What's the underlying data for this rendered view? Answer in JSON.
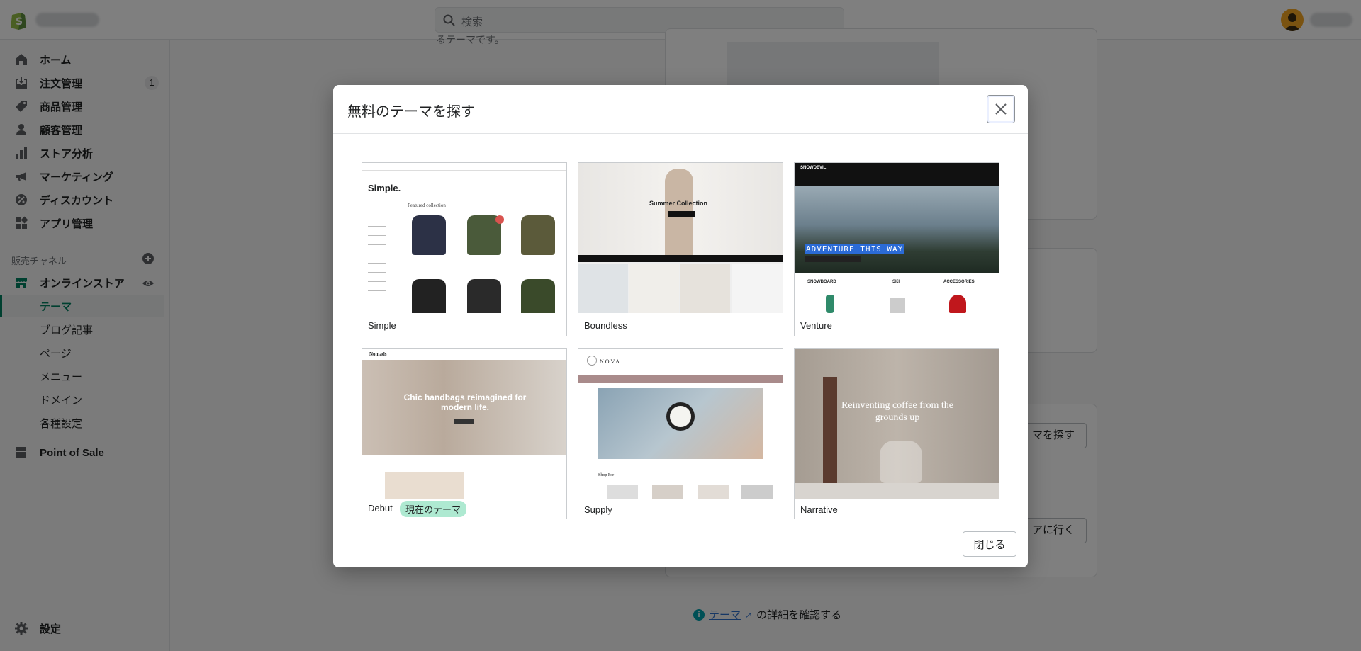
{
  "topbar": {
    "search_placeholder": "検索"
  },
  "sidebar": {
    "items": [
      {
        "label": "ホーム",
        "icon": "home-icon"
      },
      {
        "label": "注文管理",
        "icon": "orders-icon",
        "badge": "1"
      },
      {
        "label": "商品管理",
        "icon": "tag-icon"
      },
      {
        "label": "顧客管理",
        "icon": "customer-icon"
      },
      {
        "label": "ストア分析",
        "icon": "analytics-icon"
      },
      {
        "label": "マーケティング",
        "icon": "megaphone-icon"
      },
      {
        "label": "ディスカウント",
        "icon": "discount-icon"
      },
      {
        "label": "アプリ管理",
        "icon": "apps-icon"
      }
    ],
    "channels_heading": "販売チャネル",
    "online_store": "オンラインストア",
    "online_store_sub": [
      {
        "label": "テーマ",
        "active": true
      },
      {
        "label": "ブログ記事"
      },
      {
        "label": "ページ"
      },
      {
        "label": "メニュー"
      },
      {
        "label": "ドメイン"
      },
      {
        "label": "各種設定"
      }
    ],
    "pos": "Point of Sale",
    "settings": "設定"
  },
  "background": {
    "top_text": "るテーマです。",
    "explore_button": "マを探す",
    "goto_button": "アに行く",
    "footer_link": "テーマ",
    "footer_text": "の詳細を確認する"
  },
  "modal": {
    "title": "無料のテーマを探す",
    "close_label": "閉じる",
    "themes": [
      {
        "name": "Simple"
      },
      {
        "name": "Boundless"
      },
      {
        "name": "Venture"
      },
      {
        "name": "Debut",
        "badge": "現在のテーマ"
      },
      {
        "name": "Supply"
      },
      {
        "name": "Narrative"
      }
    ],
    "thumb_text": {
      "simple_heading": "Simple.",
      "simple_featured": "Featured collection",
      "boundless_heading": "Summer Collection",
      "venture_brand": "SNOWDEVIL",
      "venture_heading": "ADVENTURE THIS WAY",
      "venture_cats": [
        "SNOWBOARD",
        "SKI",
        "ACCESSORIES"
      ],
      "debut_brand": "Nomads",
      "debut_heading": "Chic handbags reimagined for modern life.",
      "supply_brand": "NOVA",
      "supply_shop": "Shop For",
      "narrative_heading": "Reinventing coffee from the grounds up"
    }
  },
  "colors": {
    "accent": "#008060",
    "badge_green": "#aee9d1",
    "link": "#2c6ecb"
  }
}
